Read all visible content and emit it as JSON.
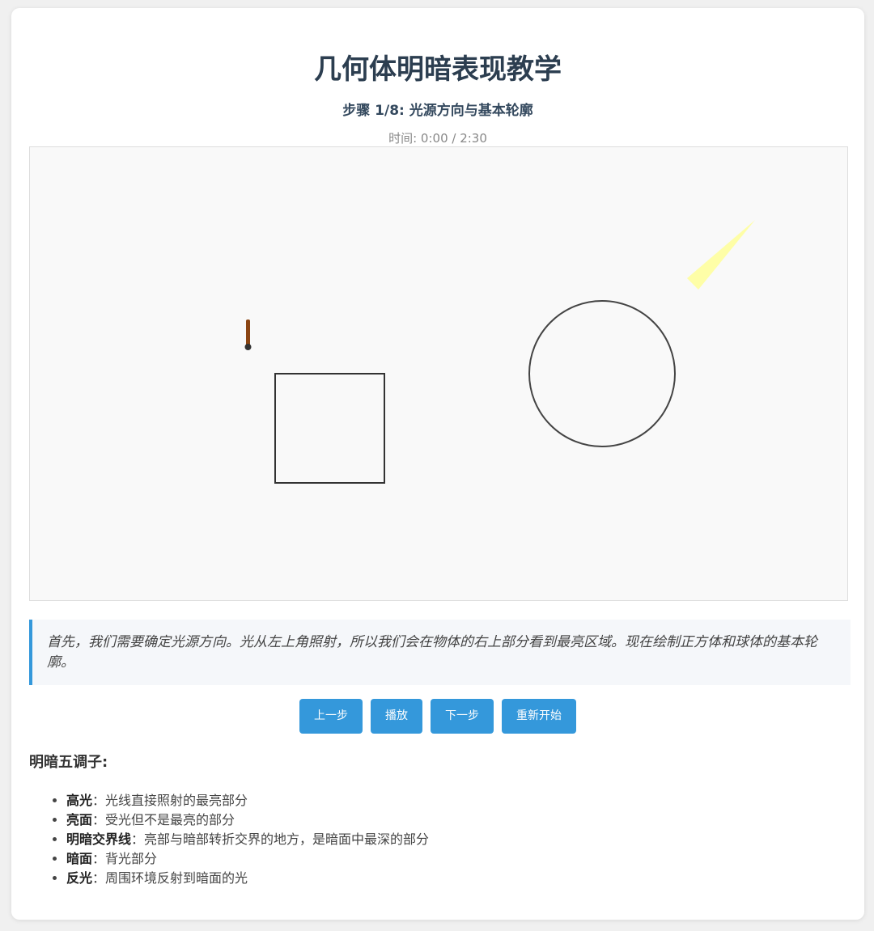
{
  "title": "几何体明暗表现教学",
  "step": {
    "title": "步骤 1/8: 光源方向与基本轮廓",
    "time": "时间: 0:00 / 2:30"
  },
  "description": "首先，我们需要确定光源方向。光从左上角照射，所以我们会在物体的右上部分看到最亮区域。现在绘制正方体和球体的基本轮廓。",
  "controls": {
    "prev": "上一步",
    "play": "播放",
    "next": "下一步",
    "restart": "重新开始"
  },
  "tones": {
    "heading": "明暗五调子:",
    "items": [
      {
        "term": "高光",
        "sep": "：",
        "desc": "光线直接照射的最亮部分"
      },
      {
        "term": "亮面",
        "sep": "：",
        "desc": "受光但不是最亮的部分"
      },
      {
        "term": "明暗交界线",
        "sep": "：",
        "desc": "亮部与暗部转折交界的地方，是暗面中最深的部分"
      },
      {
        "term": "暗面",
        "sep": "：",
        "desc": "背光部分"
      },
      {
        "term": "反光",
        "sep": "：",
        "desc": "周围环境反射到暗面的光"
      }
    ]
  },
  "colors": {
    "accent": "#3498db",
    "title": "#2c3e50",
    "light_beam": "#ffff99",
    "pencil": "#8b4513",
    "outline": "#333333"
  }
}
